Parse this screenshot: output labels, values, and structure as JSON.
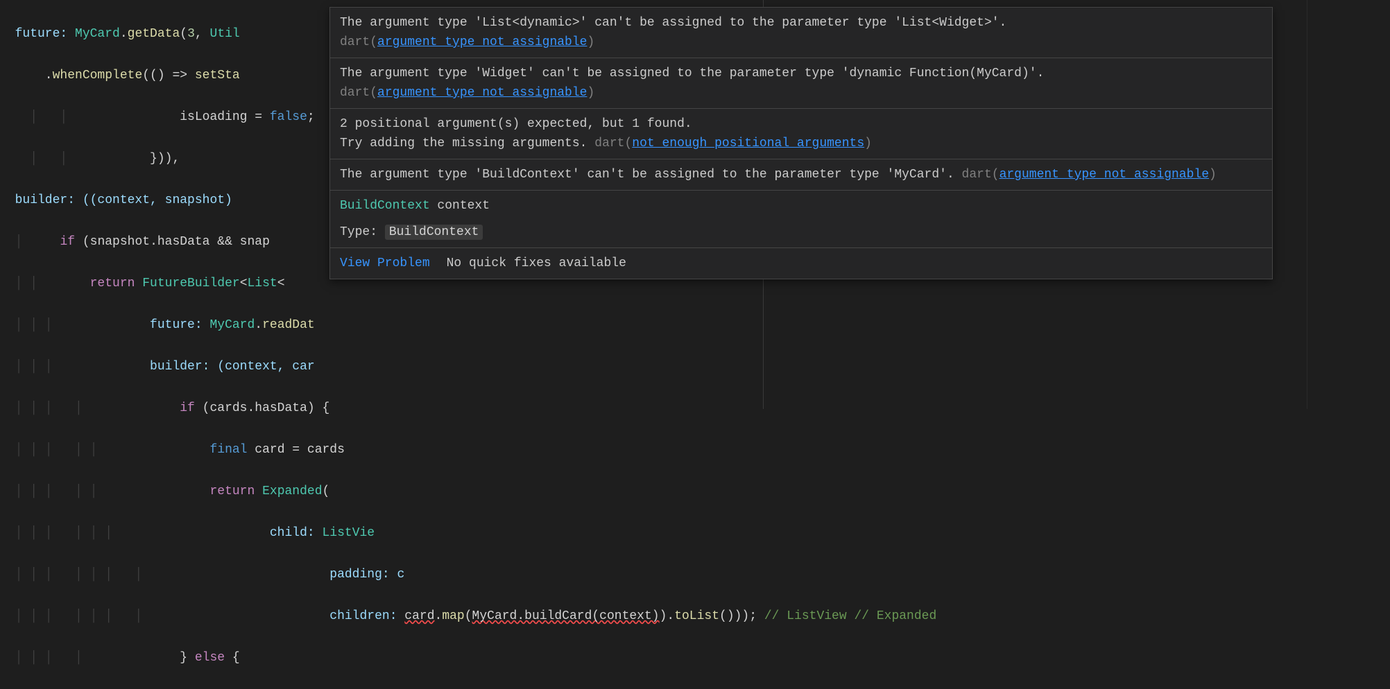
{
  "code": {
    "l1_a": "  future: ",
    "l1_cls": "MyCard",
    "l1_b": ".",
    "l1_fn": "getData",
    "l1_c": "(",
    "l1_num": "3",
    "l1_d": ", ",
    "l1_cls2": "Util",
    "l2_a": "      .",
    "l2_fn": "whenComplete",
    "l2_b": "(() => ",
    "l2_fn2": "setSta",
    "l3_a": "            isLoading = ",
    "l3_bool": "false",
    "l3_b": ";",
    "l4_a": "          })),",
    "l5_a": "  builder: ((context, snapshot) ",
    "l6_a": "    ",
    "l6_kw": "if",
    "l6_b": " (snapshot.hasData && snap",
    "l7_a": "      ",
    "l7_kw": "return",
    "l7_b": " ",
    "l7_cls": "FutureBuilder",
    "l7_c": "<",
    "l7_cls2": "List",
    "l7_d": "<",
    "l8_a": "          future: ",
    "l8_cls": "MyCard",
    "l8_b": ".",
    "l8_fn": "readDat",
    "l9_a": "          builder: (context, car",
    "l10_a": "            ",
    "l10_kw": "if",
    "l10_b": " (cards.hasData) {",
    "l11_a": "              ",
    "l11_kw": "final",
    "l11_b": " card = cards",
    "l12_a": "              ",
    "l12_kw": "return",
    "l12_b": " ",
    "l12_cls": "Expanded",
    "l12_c": "(",
    "l13_a": "                  child: ",
    "l13_cls": "ListVie",
    "l14_a": "                      padding: c",
    "l15_a": "                      children: ",
    "l15_err1": "card",
    "l15_b": ".",
    "l15_fn1": "map",
    "l15_c": "(",
    "l15_err2": "MyCard.buildCard(context)",
    "l15_d": ").",
    "l15_fn2": "toList",
    "l15_e": "())); ",
    "l15_com": "// ListView // Expanded",
    "l16_a": "            } ",
    "l16_kw": "else",
    "l16_b": " {"
  },
  "tooltip": {
    "d1_a": "The argument type 'List<dynamic>' can't be assigned to the parameter type 'List<Widget>'. ",
    "d1_src": "dart(",
    "d1_link": "argument_type_not_assignable",
    "d1_end": ")",
    "d2_a": "The argument type 'Widget' can't be assigned to the parameter type 'dynamic Function(MyCard)'. ",
    "d2_src": "dart(",
    "d2_link": "argument_type_not_assignable",
    "d2_end": ")",
    "d3_a": "2 positional argument(s) expected, but 1 found.",
    "d3_b": "Try adding the missing arguments. ",
    "d3_src": "dart(",
    "d3_link": "not_enough_positional_arguments",
    "d3_end": ")",
    "d4_a": "The argument type 'BuildContext' can't be assigned to the parameter type 'MyCard'. ",
    "d4_src": "dart(",
    "d4_link": "argument_type_not_assignable",
    "d4_end": ")",
    "sig_type": "BuildContext",
    "sig_name": " context",
    "type_label": "Type: ",
    "type_value": "BuildContext",
    "view_problem": "View Problem",
    "no_fix": "No quick fixes available"
  }
}
